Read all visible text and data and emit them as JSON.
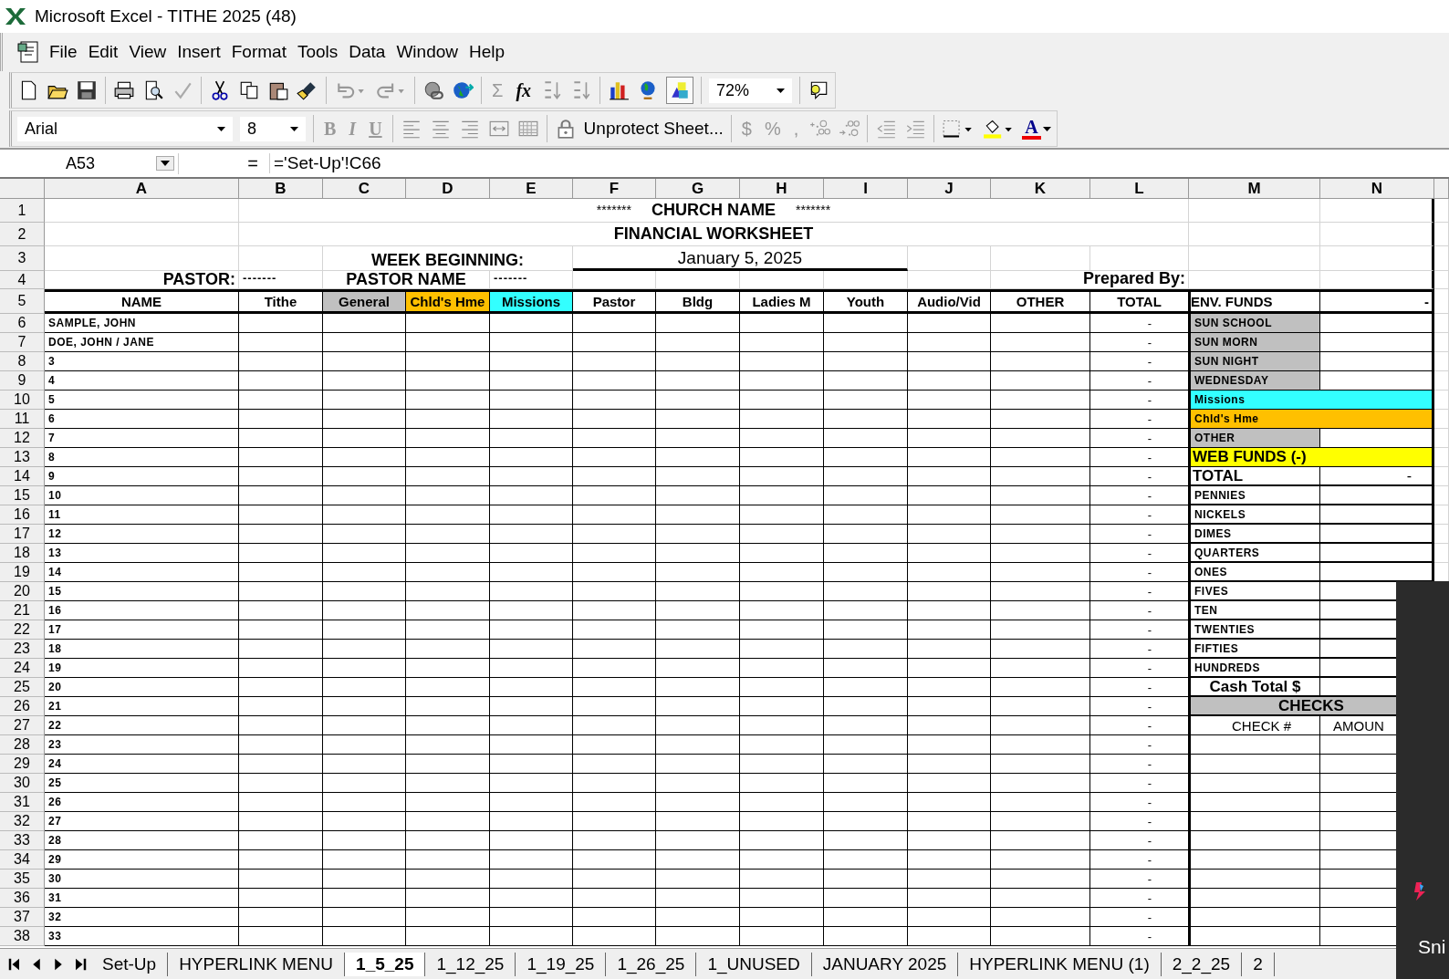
{
  "window": {
    "title": "Microsoft Excel - TITHE 2025 (48)"
  },
  "menu": [
    "File",
    "Edit",
    "View",
    "Insert",
    "Format",
    "Tools",
    "Data",
    "Window",
    "Help"
  ],
  "standard_toolbar": {
    "sum": "Σ",
    "function": "fx",
    "zoom": "72%"
  },
  "formatting_toolbar": {
    "font": "Arial",
    "size": "8",
    "bold": "B",
    "italic": "I",
    "underline": "U",
    "protect": "Unprotect Sheet...",
    "currency": "$",
    "percent": "%",
    "comma": ",",
    "font_color": "A"
  },
  "formula_bar": {
    "name_box": "A53",
    "equals": "=",
    "formula": "='Set-Up'!C66"
  },
  "columns": [
    "A",
    "B",
    "C",
    "D",
    "E",
    "F",
    "G",
    "H",
    "I",
    "J",
    "K",
    "L",
    "M",
    "N"
  ],
  "top_rows": {
    "numbers": [
      "1",
      "2",
      "3",
      "4",
      "5"
    ],
    "stars_left": "*******",
    "title": "CHURCH NAME",
    "stars_right": "*******",
    "subtitle": "FINANCIAL WORKSHEET",
    "week_label": "WEEK BEGINNING:",
    "week_value": "January 5, 2025",
    "pastor_label": "PASTOR:",
    "dashes_left": "-------",
    "pastor_name": "PASTOR NAME",
    "dashes_right": "-------",
    "prepared_by": "Prepared By:"
  },
  "headings": [
    {
      "label": "NAME"
    },
    {
      "label": "Tithe"
    },
    {
      "label": "General",
      "color": "#c0c0c0"
    },
    {
      "label": "Chld's Hme",
      "color": "#ffc000"
    },
    {
      "label": "Missions",
      "color": "#33ffff"
    },
    {
      "label": "Pastor"
    },
    {
      "label": "Bldg"
    },
    {
      "label": "Ladies M"
    },
    {
      "label": "Youth"
    },
    {
      "label": "Audio/Vid"
    },
    {
      "label": "OTHER"
    },
    {
      "label": "TOTAL"
    }
  ],
  "env_funds": {
    "heading": "ENV. FUNDS",
    "heading_value": "-",
    "rows": [
      {
        "kind": "fund",
        "label": "SUN SCHOOL",
        "color": "#c0c0c0"
      },
      {
        "kind": "fund",
        "label": "SUN MORN",
        "color": "#c0c0c0"
      },
      {
        "kind": "fund",
        "label": "SUN NIGHT",
        "color": "#c0c0c0"
      },
      {
        "kind": "fund",
        "label": "WEDNESDAY",
        "color": "#c0c0c0"
      },
      {
        "kind": "banner",
        "label": "Missions",
        "color": "#33ffff"
      },
      {
        "kind": "banner",
        "label": "Chld's Hme",
        "color": "#ffc000"
      },
      {
        "kind": "fund",
        "label": "OTHER",
        "color": "#c0c0c0"
      },
      {
        "kind": "web",
        "label": "WEB FUNDS (-)",
        "color": "#ffff00"
      },
      {
        "kind": "total",
        "label": "TOTAL",
        "value": "-"
      },
      {
        "kind": "coin",
        "label": "PENNIES"
      },
      {
        "kind": "coin",
        "label": "NICKELS"
      },
      {
        "kind": "coin",
        "label": "DIMES"
      },
      {
        "kind": "coin",
        "label": "QUARTERS"
      },
      {
        "kind": "coin",
        "label": "ONES"
      },
      {
        "kind": "coin",
        "label": "FIVES"
      },
      {
        "kind": "coin",
        "label": "TEN"
      },
      {
        "kind": "coin",
        "label": "TWENTIES"
      },
      {
        "kind": "coin",
        "label": "FIFTIES"
      },
      {
        "kind": "coin",
        "label": "HUNDREDS"
      },
      {
        "kind": "cash_total",
        "label": "Cash Total $"
      },
      {
        "kind": "section",
        "label": "CHECKS",
        "color": "#c0c0c0"
      },
      {
        "kind": "columns",
        "label": "CHECK #",
        "value": "AMOUN"
      }
    ]
  },
  "rows": [
    {
      "number": "6",
      "name": "SAMPLE, JOHN",
      "total": "-"
    },
    {
      "number": "7",
      "name": "DOE, JOHN / JANE",
      "total": "-"
    },
    {
      "number": "8",
      "name": "3",
      "total": "-"
    },
    {
      "number": "9",
      "name": "4",
      "total": "-"
    },
    {
      "number": "10",
      "name": "5",
      "total": "-"
    },
    {
      "number": "11",
      "name": "6",
      "total": "-"
    },
    {
      "number": "12",
      "name": "7",
      "total": "-"
    },
    {
      "number": "13",
      "name": "8",
      "total": "-"
    },
    {
      "number": "14",
      "name": "9",
      "total": "-"
    },
    {
      "number": "15",
      "name": "10",
      "total": "-"
    },
    {
      "number": "16",
      "name": "11",
      "total": "-"
    },
    {
      "number": "17",
      "name": "12",
      "total": "-"
    },
    {
      "number": "18",
      "name": "13",
      "total": "-"
    },
    {
      "number": "19",
      "name": "14",
      "total": "-"
    },
    {
      "number": "20",
      "name": "15",
      "total": "-"
    },
    {
      "number": "21",
      "name": "16",
      "total": "-"
    },
    {
      "number": "22",
      "name": "17",
      "total": "-"
    },
    {
      "number": "23",
      "name": "18",
      "total": "-"
    },
    {
      "number": "24",
      "name": "19",
      "total": "-"
    },
    {
      "number": "25",
      "name": "20",
      "total": "-"
    },
    {
      "number": "26",
      "name": "21",
      "total": "-"
    },
    {
      "number": "27",
      "name": "22",
      "total": "-"
    },
    {
      "number": "28",
      "name": "23",
      "total": "-"
    },
    {
      "number": "29",
      "name": "24",
      "total": "-"
    },
    {
      "number": "30",
      "name": "25",
      "total": "-"
    },
    {
      "number": "31",
      "name": "26",
      "total": "-"
    },
    {
      "number": "32",
      "name": "27",
      "total": "-"
    },
    {
      "number": "33",
      "name": "28",
      "total": "-"
    },
    {
      "number": "34",
      "name": "29",
      "total": "-"
    },
    {
      "number": "35",
      "name": "30",
      "total": "-"
    },
    {
      "number": "36",
      "name": "31",
      "total": "-"
    },
    {
      "number": "37",
      "name": "32",
      "total": "-"
    },
    {
      "number": "38",
      "name": "33",
      "total": "-"
    }
  ],
  "sheet_tabs": [
    {
      "label": "Set-Up",
      "selected": false
    },
    {
      "label": "HYPERLINK MENU",
      "selected": false
    },
    {
      "label": "1_5_25",
      "selected": true
    },
    {
      "label": "1_12_25",
      "selected": false
    },
    {
      "label": "1_19_25",
      "selected": false
    },
    {
      "label": "1_26_25",
      "selected": false
    },
    {
      "label": "1_UNUSED",
      "selected": false
    },
    {
      "label": "JANUARY 2025",
      "selected": false
    },
    {
      "label": "HYPERLINK MENU (1)",
      "selected": false
    },
    {
      "label": "2_2_25",
      "selected": false
    },
    {
      "label": "2",
      "selected": false
    }
  ],
  "popup": {
    "text": "Sni"
  }
}
